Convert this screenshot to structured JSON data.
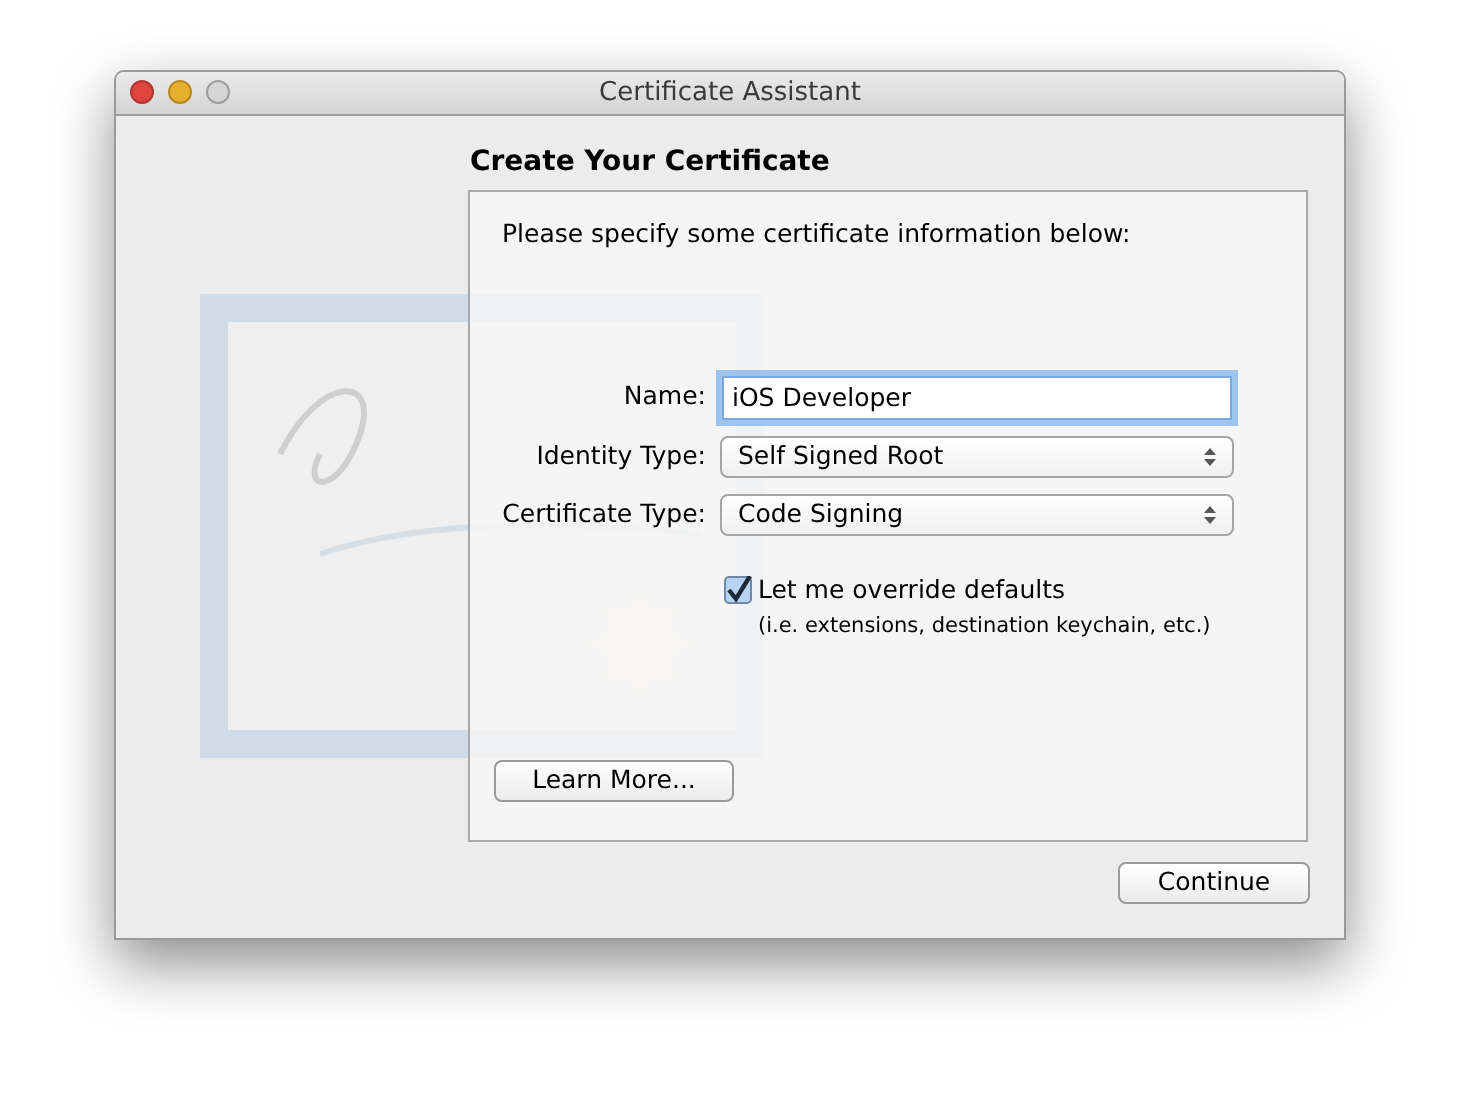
{
  "window": {
    "title": "Certificate Assistant"
  },
  "heading": "Create Your Certificate",
  "intro": "Please specify some certificate information below:",
  "fields": [
    {
      "kind": "text",
      "label": "Name:",
      "value": "iOS Developer",
      "focused": true
    },
    {
      "kind": "select",
      "label": "Identity Type:",
      "value": "Self Signed Root"
    },
    {
      "kind": "select",
      "label": "Certificate Type:",
      "value": "Code Signing"
    }
  ],
  "override": {
    "label": "Let me override defaults",
    "note": "(i.e. extensions, destination keychain, etc.)",
    "checked": true
  },
  "buttons": {
    "learn_more": "Learn More...",
    "continue": "Continue"
  }
}
